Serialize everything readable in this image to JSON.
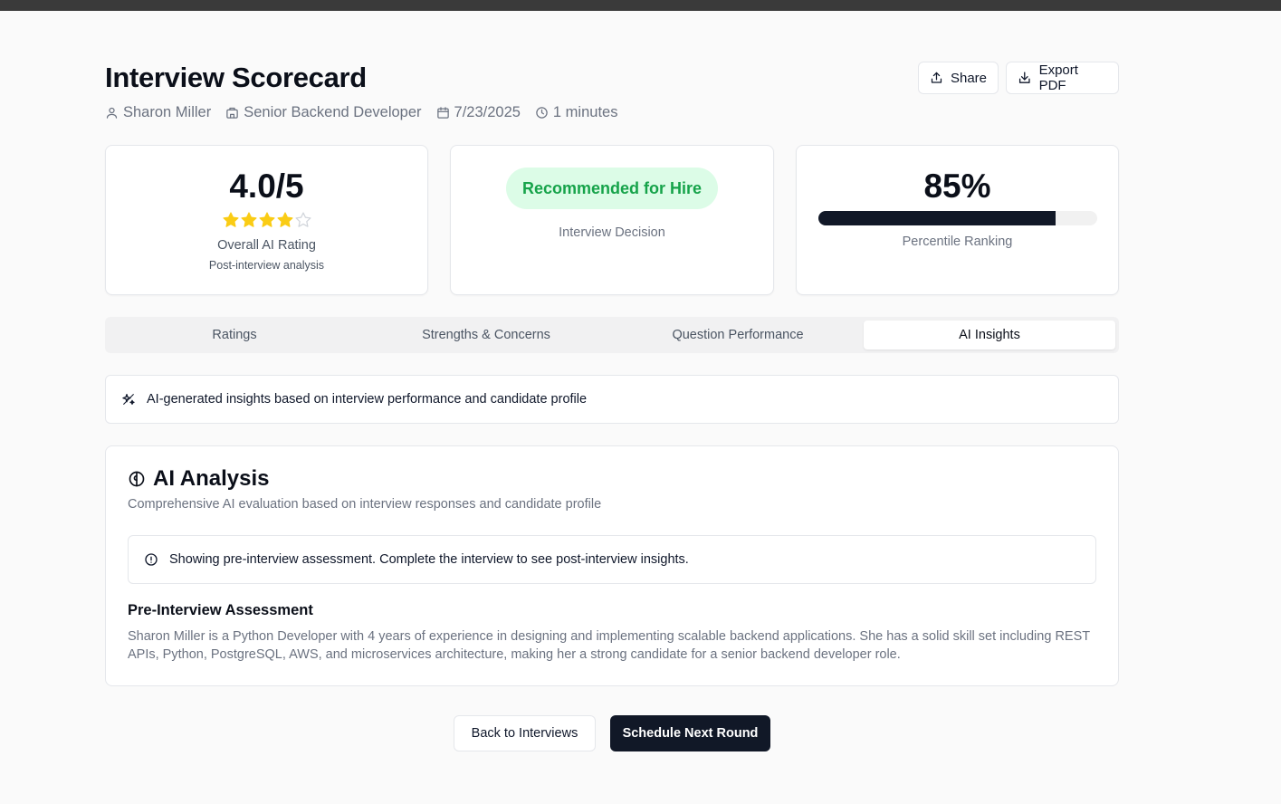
{
  "header": {
    "title": "Interview Scorecard",
    "share_label": "Share",
    "export_label": "Export PDF"
  },
  "meta": {
    "candidate": "Sharon Miller",
    "role": "Senior Backend Developer",
    "date": "7/23/2025",
    "duration": "1 minutes"
  },
  "rating_card": {
    "value": "4.0/5",
    "stars_filled": 4,
    "stars_total": 5,
    "label": "Overall AI Rating",
    "sublabel": "Post-interview analysis"
  },
  "decision_card": {
    "badge": "Recommended for Hire",
    "label": "Interview Decision"
  },
  "percentile_card": {
    "value": "85%",
    "progress_fraction": 0.85,
    "label": "Percentile Ranking"
  },
  "tabs": [
    {
      "label": "Ratings",
      "active": false
    },
    {
      "label": "Strengths & Concerns",
      "active": false
    },
    {
      "label": "Question Performance",
      "active": false
    },
    {
      "label": "AI Insights",
      "active": true
    }
  ],
  "insights_notice": "AI-generated insights based on interview performance and candidate profile",
  "analysis": {
    "title": "AI Analysis",
    "description": "Comprehensive AI evaluation based on interview responses and candidate profile",
    "alert": "Showing pre-interview assessment. Complete the interview to see post-interview insights.",
    "pre_heading": "Pre-Interview Assessment",
    "pre_text": "Sharon Miller is a Python Developer with 4 years of experience in designing and implementing scalable backend applications. She has a solid skill set including REST APIs, Python, PostgreSQL, AWS, and microservices architecture, making her a strong candidate for a senior backend developer role."
  },
  "footer": {
    "back_label": "Back to Interviews",
    "next_label": "Schedule Next Round"
  },
  "colors": {
    "star_filled": "#facc15",
    "star_empty": "#d1d5db",
    "badge_bg": "#dcfce7",
    "badge_text": "#16a34a",
    "primary": "#111827"
  }
}
